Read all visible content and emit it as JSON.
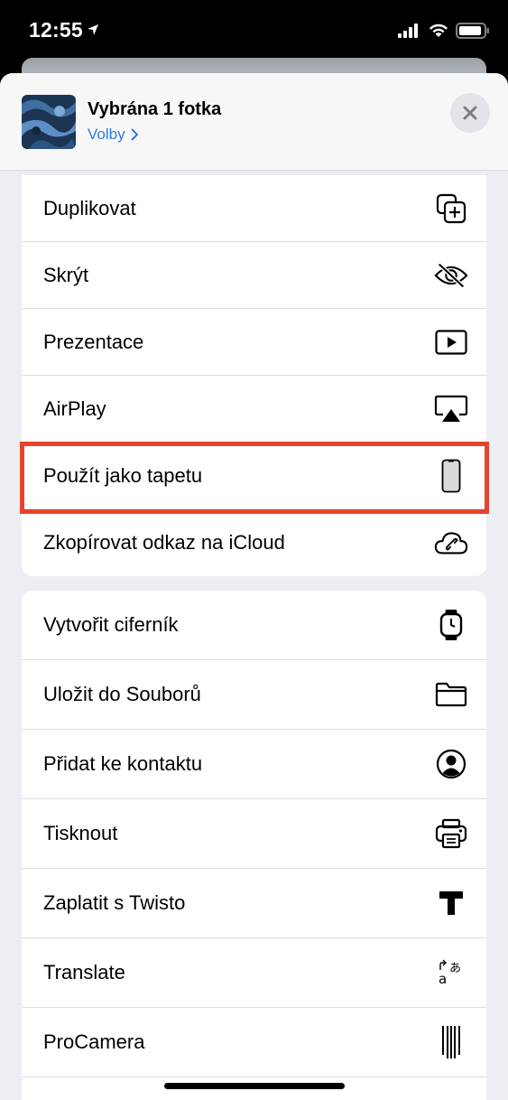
{
  "status_bar": {
    "time": "12:55"
  },
  "header": {
    "title": "Vybrána 1 fotka",
    "options_label": "Volby"
  },
  "group1": [
    {
      "label": "Duplikovat",
      "icon": "duplicate-icon"
    },
    {
      "label": "Skrýt",
      "icon": "eye-slash-icon"
    },
    {
      "label": "Prezentace",
      "icon": "play-icon"
    },
    {
      "label": "AirPlay",
      "icon": "airplay-icon"
    },
    {
      "label": "Použít jako tapetu",
      "icon": "iphone-icon"
    },
    {
      "label": "Zkopírovat odkaz na iCloud",
      "icon": "cloud-link-icon"
    }
  ],
  "group2": [
    {
      "label": "Vytvořit ciferník",
      "icon": "watch-icon"
    },
    {
      "label": "Uložit do Souborů",
      "icon": "folder-icon"
    },
    {
      "label": "Přidat ke kontaktu",
      "icon": "person-circle-icon"
    },
    {
      "label": "Tisknout",
      "icon": "printer-icon"
    },
    {
      "label": "Zaplatit s Twisto",
      "icon": "twisto-icon"
    },
    {
      "label": "Translate",
      "icon": "translate-icon"
    },
    {
      "label": "ProCamera",
      "icon": "procamera-icon"
    }
  ],
  "colors": {
    "accent": "#2f7be5",
    "highlight": "#e5432d"
  }
}
